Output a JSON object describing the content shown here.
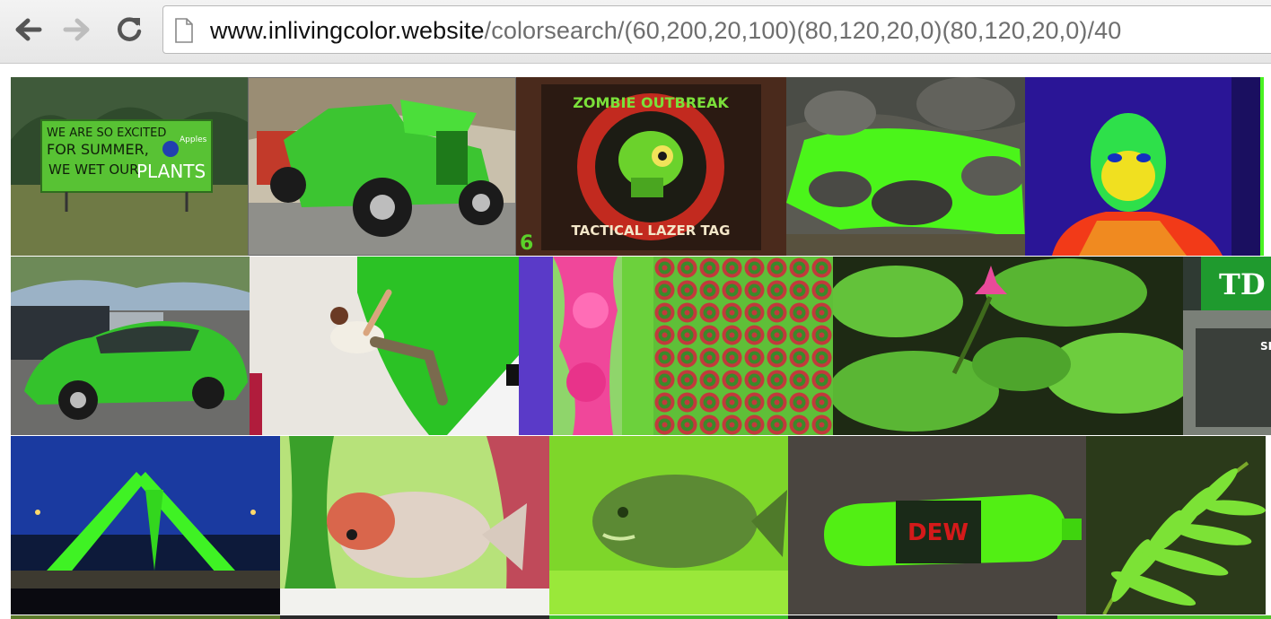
{
  "browser": {
    "back_icon": "arrow-left-icon",
    "forward_icon": "arrow-right-icon",
    "reload_icon": "reload-icon",
    "url_host": "www.inlivingcolor.website",
    "url_path": "/colorsearch/(60,200,20,100)(80,120,20,0)(80,120,20,0)/40"
  },
  "images": {
    "sign": {
      "line1": "WE ARE SO EXCITED",
      "line2": "FOR SUMMER,",
      "line3": "WE WET OUR",
      "word": "PLANTS",
      "apples": "Apples"
    },
    "zombie": {
      "title": "ZOMBIE OUTBREAK",
      "subtitle": "TACTICAL LAZER TAG",
      "corner": "6"
    },
    "bank": {
      "logo": "TD",
      "sign": "SE"
    },
    "soda": {
      "brand": "DEW"
    }
  },
  "colors": {
    "accent_green": "#4bd820",
    "bright_green": "#5aff12"
  }
}
